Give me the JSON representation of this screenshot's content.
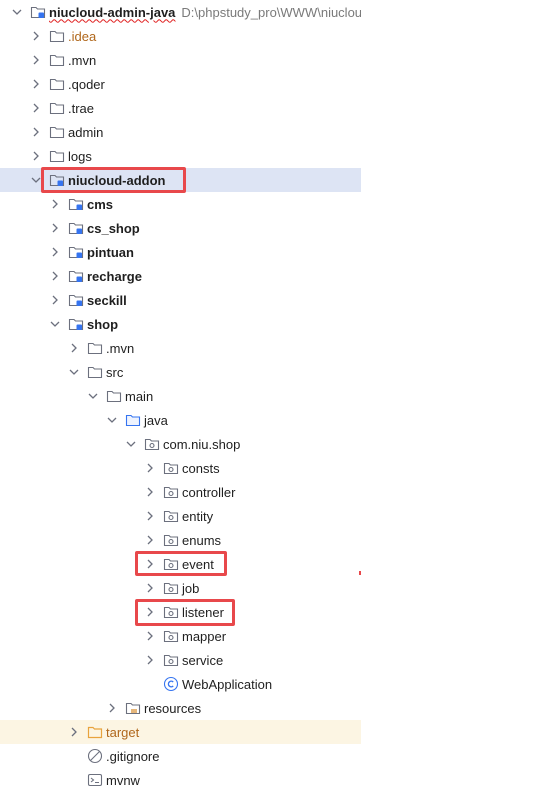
{
  "root": {
    "label": "niucloud-admin-java",
    "path": "D:\\phpstudy_pro\\WWW\\niuclou"
  },
  "items": [
    {
      "label": ".idea"
    },
    {
      "label": ".mvn"
    },
    {
      "label": ".qoder"
    },
    {
      "label": ".trae"
    },
    {
      "label": "admin"
    },
    {
      "label": "logs"
    },
    {
      "label": "niucloud-addon"
    },
    {
      "label": "cms"
    },
    {
      "label": "cs_shop"
    },
    {
      "label": "pintuan"
    },
    {
      "label": "recharge"
    },
    {
      "label": "seckill"
    },
    {
      "label": "shop"
    },
    {
      "label": ".mvn"
    },
    {
      "label": "src"
    },
    {
      "label": "main"
    },
    {
      "label": "java"
    },
    {
      "label": "com.niu.shop"
    },
    {
      "label": "consts"
    },
    {
      "label": "controller"
    },
    {
      "label": "entity"
    },
    {
      "label": "enums"
    },
    {
      "label": "event"
    },
    {
      "label": "job"
    },
    {
      "label": "listener"
    },
    {
      "label": "mapper"
    },
    {
      "label": "service"
    },
    {
      "label": "WebApplication"
    },
    {
      "label": "resources"
    },
    {
      "label": "target"
    },
    {
      "label": ".gitignore"
    },
    {
      "label": "mvnw"
    }
  ],
  "colors": {
    "selection": "#dde4f4",
    "target_row": "#fcf5e3",
    "highlight_box": "#e8484b",
    "folder_stroke": "#6c707e",
    "module_badge": "#3574f0",
    "target_folder": "#e8a33d"
  }
}
